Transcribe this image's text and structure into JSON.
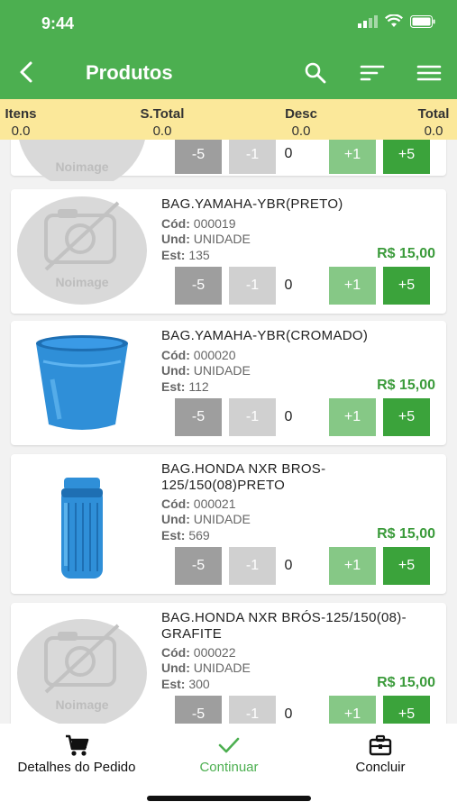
{
  "status": {
    "time": "9:44"
  },
  "appbar": {
    "title": "Produtos"
  },
  "icons": {
    "back": "chevron-left-icon",
    "search": "search-icon",
    "sort": "sort-icon",
    "menu": "menu-icon"
  },
  "summary": {
    "itens_label": "Itens",
    "itens_value": "0.0",
    "stotal_label": "S.Total",
    "stotal_value": "0.0",
    "desc_label": "Desc",
    "desc_value": "0.0",
    "total_label": "Total",
    "total_value": "0.0"
  },
  "placeholder": {
    "text": "Noimage"
  },
  "products": [
    {
      "name": "",
      "cod": "",
      "und": "",
      "est": "",
      "price": "",
      "qty": "0"
    },
    {
      "name": "BAG.YAMAHA-YBR(PRETO)",
      "cod": "000019",
      "und": "UNIDADE",
      "est": "135",
      "price": "R$ 15,00",
      "qty": "0"
    },
    {
      "name": "BAG.YAMAHA-YBR(CROMADO)",
      "cod": "000020",
      "und": "UNIDADE",
      "est": "112",
      "price": "R$ 15,00",
      "qty": "0"
    },
    {
      "name": "BAG.HONDA NXR BROS-125/150(08)PRETO",
      "cod": "000021",
      "und": "UNIDADE",
      "est": "569",
      "price": "R$ 15,00",
      "qty": "0"
    },
    {
      "name": "BAG.HONDA NXR BRÓS-125/150(08)-GRAFITE",
      "cod": "000022",
      "und": "UNIDADE",
      "est": "300",
      "price": "R$ 15,00",
      "qty": "0"
    }
  ],
  "labels": {
    "cod": "Cód:",
    "und": "Und:",
    "est": "Est:",
    "minus5": "-5",
    "minus1": "-1",
    "plus1": "+1",
    "plus5": "+5"
  },
  "bottom": {
    "details": "Detalhes do Pedido",
    "continue": "Continuar",
    "finish": "Concluir"
  },
  "colors": {
    "primary": "#4caf50",
    "summary_bg": "#fbe89a",
    "price": "#3b9b3b",
    "accent_tab": "#4caf50"
  }
}
